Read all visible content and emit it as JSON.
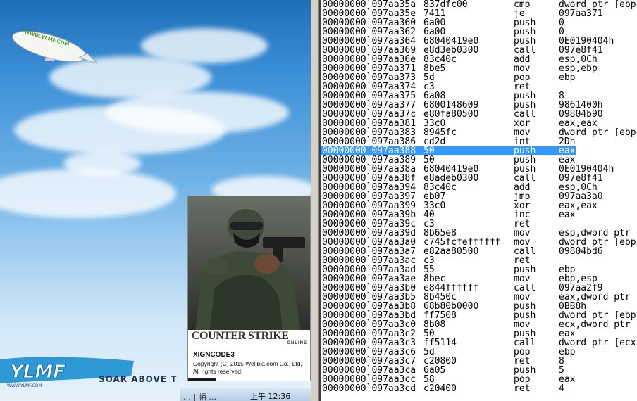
{
  "colors": {
    "selection": "#3399ff",
    "disasm_bg": "#ffffff",
    "sky_top": "#1f6fb8"
  },
  "desktop": {
    "blimp_text": "WWW.YLMF.COM",
    "logo_text": "YLMF",
    "logo_url": "WWW.YLMF.COM",
    "slogan": "SOAR ABOVE T",
    "clock": "上午 12:36",
    "tray_text": "… | 帞 …"
  },
  "splash": {
    "game_title": "COUNTER STRIKE",
    "game_sub": "ONLINE",
    "product": "XIGNCODE3",
    "copyright": "Copyright (C) 2015 Wellbia.com Co., Ltd, All rights reserved."
  },
  "disasm": {
    "selected_index": 16,
    "rows": [
      {
        "addr": "00000000`097aa35a",
        "bytes": "837dfc00",
        "mnem": "cmp",
        "ops": "dword ptr [ebp"
      },
      {
        "addr": "00000000`097aa35e",
        "bytes": "7411",
        "mnem": "je",
        "ops": "097aa371"
      },
      {
        "addr": "00000000`097aa360",
        "bytes": "6a00",
        "mnem": "push",
        "ops": "0"
      },
      {
        "addr": "00000000`097aa362",
        "bytes": "6a00",
        "mnem": "push",
        "ops": "0"
      },
      {
        "addr": "00000000`097aa364",
        "bytes": "68040419e0",
        "mnem": "push",
        "ops": "0E0190404h"
      },
      {
        "addr": "00000000`097aa369",
        "bytes": "e8d3eb0300",
        "mnem": "call",
        "ops": "097e8f41"
      },
      {
        "addr": "00000000`097aa36e",
        "bytes": "83c40c",
        "mnem": "add",
        "ops": "esp,0Ch"
      },
      {
        "addr": "00000000`097aa371",
        "bytes": "8be5",
        "mnem": "mov",
        "ops": "esp,ebp"
      },
      {
        "addr": "00000000`097aa373",
        "bytes": "5d",
        "mnem": "pop",
        "ops": "ebp"
      },
      {
        "addr": "00000000`097aa374",
        "bytes": "c3",
        "mnem": "ret",
        "ops": ""
      },
      {
        "addr": "00000000`097aa375",
        "bytes": "6a08",
        "mnem": "push",
        "ops": "8"
      },
      {
        "addr": "00000000`097aa377",
        "bytes": "6800148609",
        "mnem": "push",
        "ops": "9861400h"
      },
      {
        "addr": "00000000`097aa37c",
        "bytes": "e80fa80500",
        "mnem": "call",
        "ops": "09804b90"
      },
      {
        "addr": "00000000`097aa381",
        "bytes": "33c0",
        "mnem": "xor",
        "ops": "eax,eax"
      },
      {
        "addr": "00000000`097aa383",
        "bytes": "8945fc",
        "mnem": "mov",
        "ops": "dword ptr [ebp"
      },
      {
        "addr": "00000000`097aa386",
        "bytes": "cd2d",
        "mnem": "int",
        "ops": "2Dh"
      },
      {
        "addr": "00000000`097aa388",
        "bytes": "50",
        "mnem": "push",
        "ops": "eax"
      },
      {
        "addr": "00000000`097aa389",
        "bytes": "50",
        "mnem": "push",
        "ops": "eax"
      },
      {
        "addr": "00000000`097aa38a",
        "bytes": "68040419e0",
        "mnem": "push",
        "ops": "0E0190404h"
      },
      {
        "addr": "00000000`097aa38f",
        "bytes": "e8adeb0300",
        "mnem": "call",
        "ops": "097e8f41"
      },
      {
        "addr": "00000000`097aa394",
        "bytes": "83c40c",
        "mnem": "add",
        "ops": "esp,0Ch"
      },
      {
        "addr": "00000000`097aa397",
        "bytes": "eb07",
        "mnem": "jmp",
        "ops": "097aa3a0"
      },
      {
        "addr": "00000000`097aa399",
        "bytes": "33c0",
        "mnem": "xor",
        "ops": "eax,eax"
      },
      {
        "addr": "00000000`097aa39b",
        "bytes": "40",
        "mnem": "inc",
        "ops": "eax"
      },
      {
        "addr": "00000000`097aa39c",
        "bytes": "c3",
        "mnem": "ret",
        "ops": ""
      },
      {
        "addr": "00000000`097aa39d",
        "bytes": "8b65e8",
        "mnem": "mov",
        "ops": "esp,dword ptr"
      },
      {
        "addr": "00000000`097aa3a0",
        "bytes": "c745fcfeffffff",
        "mnem": "mov",
        "ops": "dword ptr [ebp"
      },
      {
        "addr": "00000000`097aa3a7",
        "bytes": "e82aa80500",
        "mnem": "call",
        "ops": "09804bd6"
      },
      {
        "addr": "00000000`097aa3ac",
        "bytes": "c3",
        "mnem": "ret",
        "ops": ""
      },
      {
        "addr": "00000000`097aa3ad",
        "bytes": "55",
        "mnem": "push",
        "ops": "ebp"
      },
      {
        "addr": "00000000`097aa3ae",
        "bytes": "8bec",
        "mnem": "mov",
        "ops": "ebp,esp"
      },
      {
        "addr": "00000000`097aa3b0",
        "bytes": "e844ffffff",
        "mnem": "call",
        "ops": "097aa2f9"
      },
      {
        "addr": "00000000`097aa3b5",
        "bytes": "8b450c",
        "mnem": "mov",
        "ops": "eax,dword ptr"
      },
      {
        "addr": "00000000`097aa3b8",
        "bytes": "68b80b0000",
        "mnem": "push",
        "ops": "0BB8h"
      },
      {
        "addr": "00000000`097aa3bd",
        "bytes": "ff7508",
        "mnem": "push",
        "ops": "dword ptr [ebp"
      },
      {
        "addr": "00000000`097aa3c0",
        "bytes": "8b08",
        "mnem": "mov",
        "ops": "ecx,dword ptr"
      },
      {
        "addr": "00000000`097aa3c2",
        "bytes": "50",
        "mnem": "push",
        "ops": "eax"
      },
      {
        "addr": "00000000`097aa3c3",
        "bytes": "ff5114",
        "mnem": "call",
        "ops": "dword ptr [ecx"
      },
      {
        "addr": "00000000`097aa3c6",
        "bytes": "5d",
        "mnem": "pop",
        "ops": "ebp"
      },
      {
        "addr": "00000000`097aa3c7",
        "bytes": "c20800",
        "mnem": "ret",
        "ops": "8"
      },
      {
        "addr": "00000000`097aa3ca",
        "bytes": "6a05",
        "mnem": "push",
        "ops": "5"
      },
      {
        "addr": "00000000`097aa3cc",
        "bytes": "58",
        "mnem": "pop",
        "ops": "eax"
      },
      {
        "addr": "00000000`097aa3cd",
        "bytes": "c20400",
        "mnem": "ret",
        "ops": "4"
      }
    ]
  }
}
